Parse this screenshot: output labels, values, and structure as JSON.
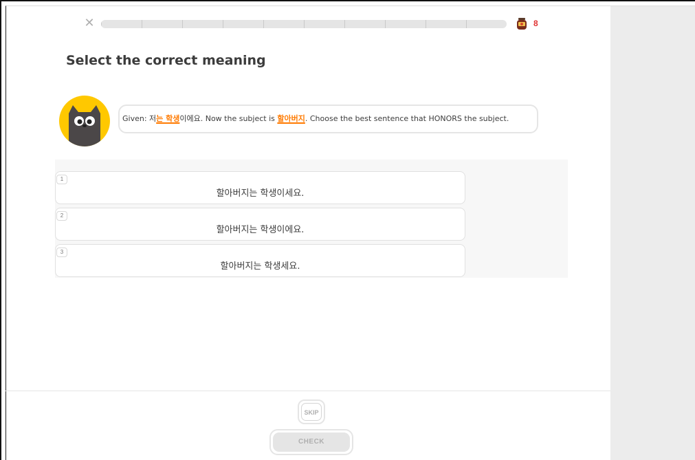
{
  "header": {
    "close_icon": "close-icon",
    "progress": {
      "fraction": 0.0,
      "segments": 10
    },
    "streak": {
      "icon": "jar-icon",
      "count": "8",
      "color": "#e03333"
    }
  },
  "prompt": {
    "title": "Select the correct meaning",
    "avatar_icon": "cat-character-icon",
    "bubble": {
      "pre": "Given: 저",
      "highlight1": "는 학생",
      "mid1": "이에요. Now the subject is ",
      "highlight2": "할아버지",
      "post": ". Choose the best sentence that HONORS the subject."
    },
    "highlight_color": "#ff7a00"
  },
  "options": [
    {
      "number": "1",
      "text": "할아버지는 학생이세요."
    },
    {
      "number": "2",
      "text": "할아버지는 학생이에요."
    },
    {
      "number": "3",
      "text": "할아버지는 학생세요."
    }
  ],
  "footer": {
    "skip_label": "SKIP",
    "check_label": "CHECK"
  }
}
